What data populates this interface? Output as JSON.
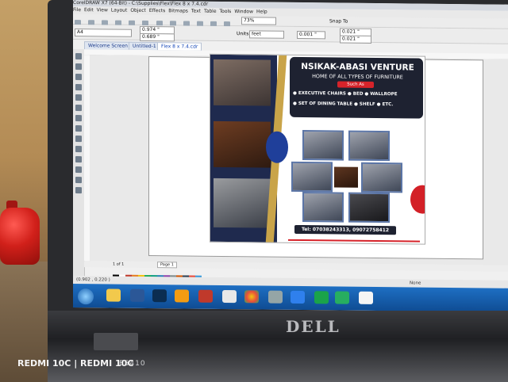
{
  "photo_watermark": "REDMI 10C | REDMI 10C",
  "laptop": {
    "brand": "DELL",
    "model": "E5410"
  },
  "app": {
    "title": "CorelDRAW X7 (64-Bit) - C:\\Supplies\\Flex\\Flex 8 x 7.4.cdr",
    "menu": [
      "File",
      "Edit",
      "View",
      "Layout",
      "Object",
      "Effects",
      "Bitmaps",
      "Text",
      "Table",
      "Tools",
      "Window",
      "Help"
    ],
    "zoom": "73%",
    "snap_to": "Snap To",
    "page_size": "A4",
    "width_value": "0.974 \"",
    "height_value": "0.689 \"",
    "units_label": "Units:",
    "units_value": "feet",
    "nudge": "0.001 \"",
    "dup_x": "0.021 \"",
    "dup_y": "0.021 \"",
    "tabs": [
      "Welcome Screen",
      "Untitled-1",
      "Flex 8 x 7.4.cdr"
    ],
    "page_nav": "1 of 1",
    "page_tab": "Page 1",
    "coords": "(0.902 , 0.220 )",
    "fill_status": "None"
  },
  "flyer": {
    "headline": "NSIKAK-ABASI VENTURE",
    "subhead": "HOME OF ALL TYPES OF FURNITURE",
    "such_as": "Such As",
    "items_row1": "● EXECUTIVE CHAIRS  ● BED  ● WALLROPE",
    "items_row2": "● SET OF DINING TABLE  ● SHELF  ● ETC.",
    "tel": "Tel: 07038243313, 09072758412"
  },
  "palette_colors": [
    "#000000",
    "#ffffff",
    "#c0392b",
    "#e67e22",
    "#f1c40f",
    "#27ae60",
    "#16a085",
    "#2980b9",
    "#8e44ad",
    "#7f8c8d",
    "#d35400",
    "#2c3e50",
    "#e74c3c",
    "#3498db"
  ]
}
